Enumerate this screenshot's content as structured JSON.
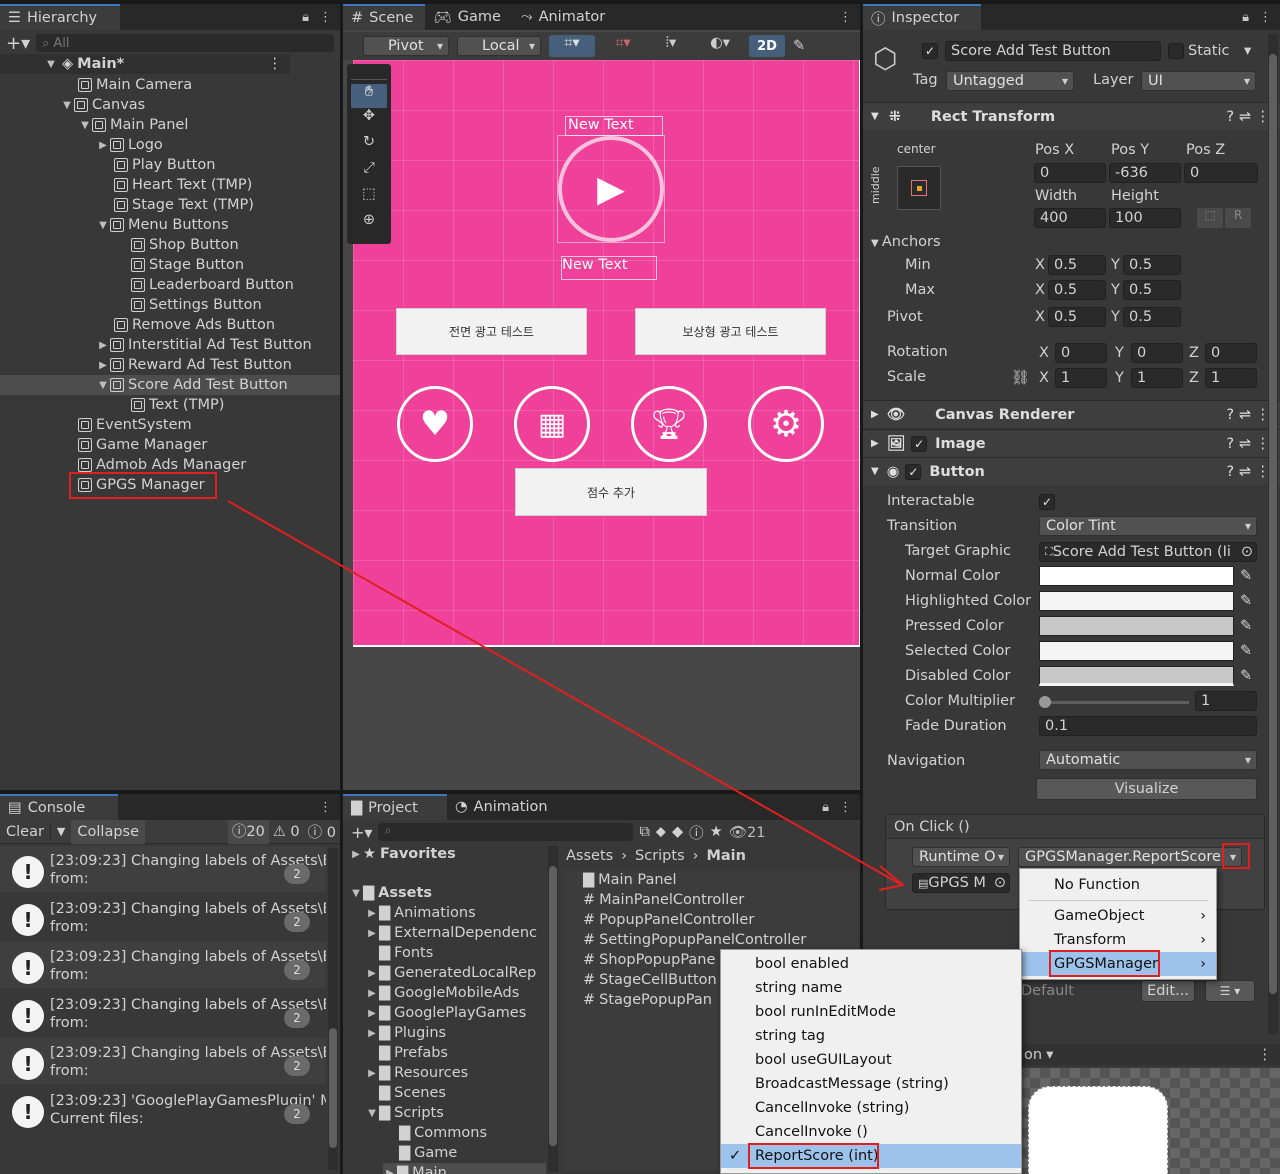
{
  "hierarchy": {
    "tab": "Hierarchy",
    "search_placeholder": "All",
    "items": [
      {
        "label": "Main*"
      },
      {
        "label": "Main Camera"
      },
      {
        "label": "Canvas"
      },
      {
        "label": "Main Panel"
      },
      {
        "label": "Logo"
      },
      {
        "label": "Play Button"
      },
      {
        "label": "Heart Text (TMP)"
      },
      {
        "label": "Stage Text (TMP)"
      },
      {
        "label": "Menu Buttons"
      },
      {
        "label": "Shop Button"
      },
      {
        "label": "Stage Button"
      },
      {
        "label": "Leaderboard Button"
      },
      {
        "label": "Settings Button"
      },
      {
        "label": "Remove Ads Button"
      },
      {
        "label": "Interstitial Ad Test Button"
      },
      {
        "label": "Reward Ad Test Button"
      },
      {
        "label": "Score Add Test Button"
      },
      {
        "label": "Text (TMP)"
      },
      {
        "label": "EventSystem"
      },
      {
        "label": "Game Manager"
      },
      {
        "label": "Admob Ads Manager"
      },
      {
        "label": "GPGS Manager"
      }
    ]
  },
  "scene": {
    "tabs": [
      "Scene",
      "Game",
      "Animator"
    ],
    "pivot": "Pivot",
    "local": "Local",
    "mode2d": "2D",
    "new_text_1": "New Text",
    "new_text_2": "New Text",
    "btn_interstitial": "전면 광고 테스트",
    "btn_reward": "보상형 광고 테스트",
    "btn_score": "점수 추가",
    "bg_color": "#f0419a"
  },
  "inspector": {
    "tab": "Inspector",
    "object_name": "Score Add Test Button",
    "static": "Static",
    "tag_label": "Tag",
    "tag_value": "Untagged",
    "layer_label": "Layer",
    "layer_value": "UI",
    "rect_transform": "Rect Transform",
    "anchor_h": "center",
    "anchor_v": "middle",
    "pos_x_label": "Pos X",
    "pos_y_label": "Pos Y",
    "pos_z_label": "Pos Z",
    "pos_x": "0",
    "pos_y": "-636",
    "pos_z": "0",
    "width_label": "Width",
    "height_label": "Height",
    "width": "400",
    "height": "100",
    "anchors": "Anchors",
    "min": "Min",
    "max": "Max",
    "pivot": "Pivot",
    "min_x": "0.5",
    "min_y": "0.5",
    "max_x": "0.5",
    "max_y": "0.5",
    "pivot_x": "0.5",
    "pivot_y": "0.5",
    "rotation": "Rotation",
    "scale": "Scale",
    "rot_x": "0",
    "rot_y": "0",
    "rot_z": "0",
    "scale_x": "1",
    "scale_y": "1",
    "scale_z": "1",
    "canvas_renderer": "Canvas Renderer",
    "image": "Image",
    "button": "Button",
    "interactable": "Interactable",
    "transition": "Transition",
    "transition_value": "Color Tint",
    "target_graphic": "Target Graphic",
    "target_graphic_value": "Score Add Test Button (Ii",
    "normal_color": "Normal Color",
    "highlighted_color": "Highlighted Color",
    "pressed_color": "Pressed Color",
    "selected_color": "Selected Color",
    "disabled_color": "Disabled Color",
    "color_multiplier": "Color Multiplier",
    "color_multiplier_value": "1",
    "fade_duration": "Fade Duration",
    "fade_duration_value": "0.1",
    "navigation": "Navigation",
    "navigation_value": "Automatic",
    "visualize": "Visualize",
    "on_click": "On Click ()",
    "runtime": "Runtime O",
    "function": "GPGSManager.ReportScore",
    "object_ref": "GPGS M",
    "default_value": "Default",
    "edit_btn": "Edit..."
  },
  "context_menu_1": {
    "items": [
      "No Function",
      "GameObject",
      "Transform",
      "GPGSManager"
    ]
  },
  "context_menu_2": {
    "items": [
      "bool enabled",
      "string name",
      "bool runInEditMode",
      "string tag",
      "bool useGUILayout",
      "BroadcastMessage (string)",
      "CancelInvoke (string)",
      "CancelInvoke ()",
      "ReportScore (int)"
    ]
  },
  "console": {
    "tab": "Console",
    "clear": "Clear",
    "collapse": "Collapse",
    "errors": "20",
    "warnings": "0",
    "info": "0",
    "logs": [
      {
        "line1": "[23:09:23] Changing labels of Assets\\E",
        "line2": "from:",
        "count": "2"
      },
      {
        "line1": "[23:09:23] Changing labels of Assets\\E",
        "line2": "from:",
        "count": "2"
      },
      {
        "line1": "[23:09:23] Changing labels of Assets\\E",
        "line2": "from:",
        "count": "2"
      },
      {
        "line1": "[23:09:23] Changing labels of Assets\\E",
        "line2": "from:",
        "count": "2"
      },
      {
        "line1": "[23:09:23] Changing labels of Assets\\E",
        "line2": "from:",
        "count": "2"
      },
      {
        "line1": "[23:09:23] 'GooglePlayGamesPlugin' M",
        "line2": "Current files:",
        "count": "2"
      }
    ]
  },
  "project": {
    "tabs": [
      "Project",
      "Animation"
    ],
    "count": "21",
    "favorites": "Favorites",
    "assets": "Assets",
    "folders": [
      "Animations",
      "ExternalDependenc",
      "Fonts",
      "GeneratedLocalRep",
      "GoogleMobileAds",
      "GooglePlayGames",
      "Plugins",
      "Prefabs",
      "Resources",
      "Scenes",
      "Scripts",
      "Commons",
      "Game",
      "Main"
    ],
    "breadcrumb": [
      "Assets",
      "Scripts",
      "Main"
    ],
    "files": [
      "Main Panel",
      "MainPanelController",
      "PopupPanelController",
      "SettingPopupPanelController",
      "ShopPopupPane",
      "StageCellButton",
      "StagePopupPan"
    ]
  },
  "anim_partial": "on"
}
